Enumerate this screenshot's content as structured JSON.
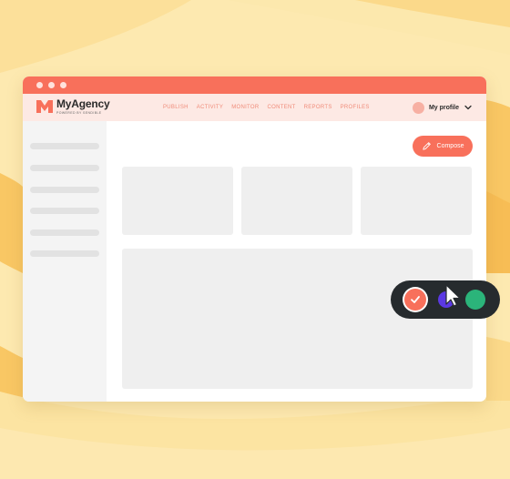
{
  "colors": {
    "background": "#fde9b0",
    "accent": "#f8705b",
    "nav_bar": "#fde9e4",
    "toolbar": "#262b2e",
    "purple": "#5b39e3",
    "green": "#2bb47a"
  },
  "app": {
    "brand_name": "MyAgency",
    "brand_tagline": "POWERED BY SENDIBLE",
    "logo_icon": "myagency-logo-icon"
  },
  "nav": {
    "items": [
      "PUBLISH",
      "ACTIVITY",
      "MONITOR",
      "CONTENT",
      "REPORTS",
      "PROFILES"
    ]
  },
  "profile": {
    "label": "My profile",
    "icon": "chevron-down-icon"
  },
  "compose": {
    "label": "Compose",
    "icon": "pencil-icon"
  },
  "toolbar": {
    "icons": [
      "check-icon",
      "purple-dot",
      "cursor-icon",
      "green-dot"
    ]
  }
}
